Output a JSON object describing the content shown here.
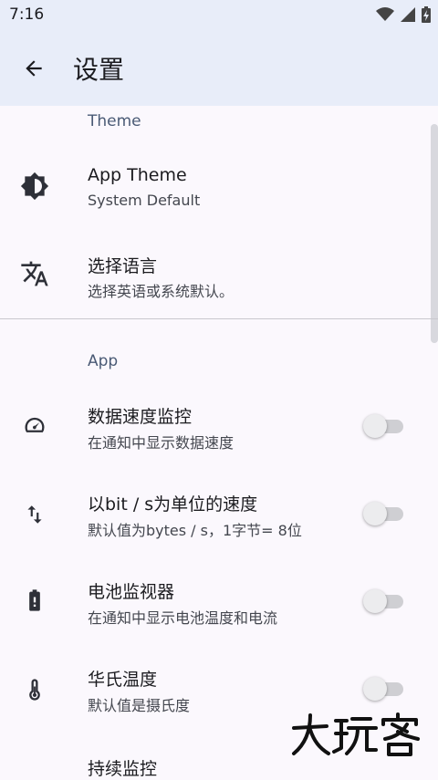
{
  "status_bar": {
    "time": "7:16",
    "icons": [
      "wifi-icon",
      "signal-icon",
      "battery-charging-icon"
    ]
  },
  "app_bar": {
    "title": "设置",
    "back_icon": "arrow-back-icon"
  },
  "sections": {
    "theme": "Theme",
    "app": "App"
  },
  "items": {
    "app_theme": {
      "title": "App Theme",
      "summary": "System Default",
      "icon": "brightness-icon"
    },
    "language": {
      "title": "选择语言",
      "summary": "选择英语或系统默认。",
      "icon": "translate-icon"
    },
    "data_speed": {
      "title": "数据速度监控",
      "summary": "在通知中显示数据速度",
      "icon": "speedometer-icon",
      "enabled": false
    },
    "bit_speed": {
      "title": "以bit / s为单位的速度",
      "summary": "默认值为bytes / s，1字节= 8位",
      "icon": "swap-vert-icon",
      "enabled": false
    },
    "battery_monitor": {
      "title": " 电池监视器",
      "summary": "在通知中显示电池温度和电流",
      "icon": "battery-alert-icon",
      "enabled": false
    },
    "fahrenheit": {
      "title": "华氏温度",
      "summary": "默认值是摄氏度",
      "icon": "thermometer-icon",
      "enabled": false
    },
    "continuous_monitor": {
      "title": "持续监控"
    }
  },
  "colors": {
    "app_bar": "#e8edf9",
    "background": "#fbf8fd",
    "section_header": "#4a5a75"
  },
  "watermark": {
    "text": "大玩客"
  }
}
